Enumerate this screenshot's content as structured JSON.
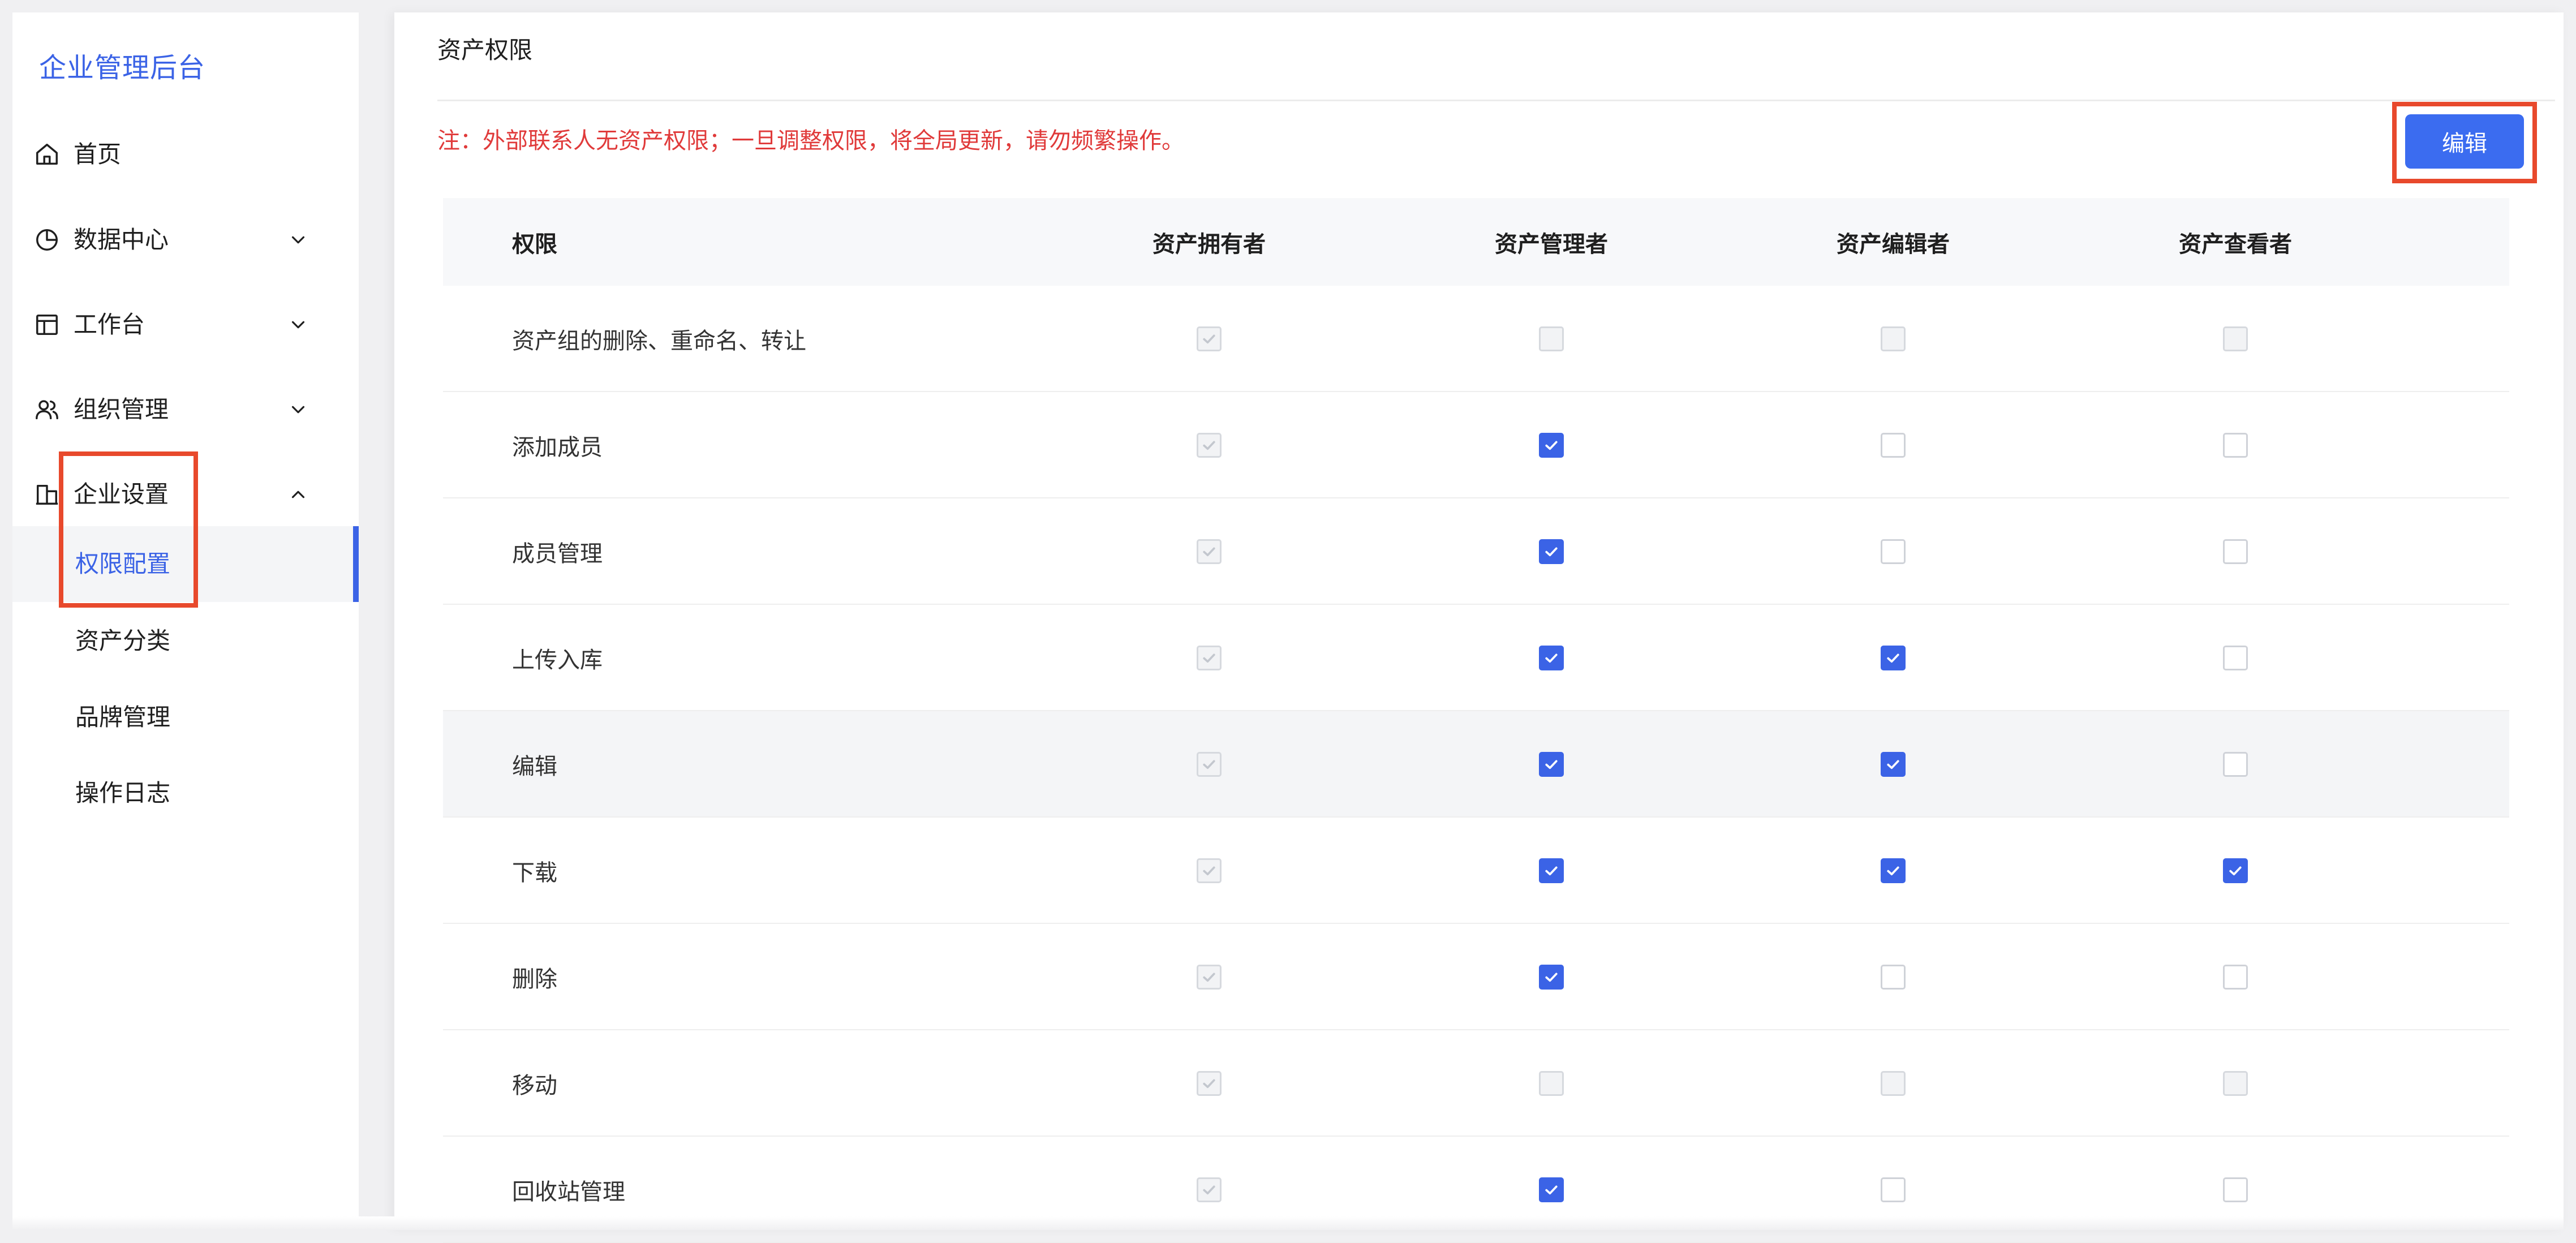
{
  "app": {
    "title": "企业管理后台"
  },
  "sidebar": {
    "items": [
      {
        "label": "首页",
        "icon": "home-icon",
        "has_chevron": false
      },
      {
        "label": "数据中心",
        "icon": "pie-chart-icon",
        "has_chevron": true,
        "chevron": "chevron-down"
      },
      {
        "label": "工作台",
        "icon": "layout-icon",
        "has_chevron": true,
        "chevron": "chevron-down"
      },
      {
        "label": "组织管理",
        "icon": "users-icon",
        "has_chevron": true,
        "chevron": "chevron-down"
      },
      {
        "label": "企业设置",
        "icon": "building-icon",
        "has_chevron": true,
        "chevron": "chevron-up",
        "expanded": true
      }
    ],
    "sub_items": [
      {
        "label": "权限配置",
        "active": true
      },
      {
        "label": "资产分类",
        "active": false
      },
      {
        "label": "品牌管理",
        "active": false
      },
      {
        "label": "操作日志",
        "active": false
      }
    ],
    "accent_color": "#3b63e6"
  },
  "main": {
    "title": "资产权限",
    "notice": "注：外部联系人无资产权限；一旦调整权限，将全局更新，请勿频繁操作。",
    "notice_color": "#e03a3a",
    "edit_button_label": "编辑",
    "highlight_color": "#e8492c"
  },
  "table": {
    "columns": [
      "权限",
      "资产拥有者",
      "资产管理者",
      "资产编辑者",
      "资产查看者"
    ],
    "rows": [
      {
        "name": "资产组的删除、重命名、转让",
        "cells": [
          "disabled-checked",
          "disabled-unchecked",
          "disabled-unchecked",
          "disabled-unchecked"
        ]
      },
      {
        "name": "添加成员",
        "cells": [
          "disabled-checked",
          "checked",
          "unchecked",
          "unchecked"
        ]
      },
      {
        "name": "成员管理",
        "cells": [
          "disabled-checked",
          "checked",
          "unchecked",
          "unchecked"
        ]
      },
      {
        "name": "上传入库",
        "cells": [
          "disabled-checked",
          "checked",
          "checked",
          "unchecked"
        ]
      },
      {
        "name": "编辑",
        "cells": [
          "disabled-checked",
          "checked",
          "checked",
          "unchecked"
        ],
        "hover": true
      },
      {
        "name": "下载",
        "cells": [
          "disabled-checked",
          "checked",
          "checked",
          "checked"
        ]
      },
      {
        "name": "删除",
        "cells": [
          "disabled-checked",
          "checked",
          "unchecked",
          "unchecked"
        ]
      },
      {
        "name": "移动",
        "cells": [
          "disabled-checked",
          "disabled-unchecked",
          "disabled-unchecked",
          "disabled-unchecked"
        ]
      },
      {
        "name": "回收站管理",
        "cells": [
          "disabled-checked",
          "checked",
          "unchecked",
          "unchecked"
        ]
      }
    ]
  }
}
